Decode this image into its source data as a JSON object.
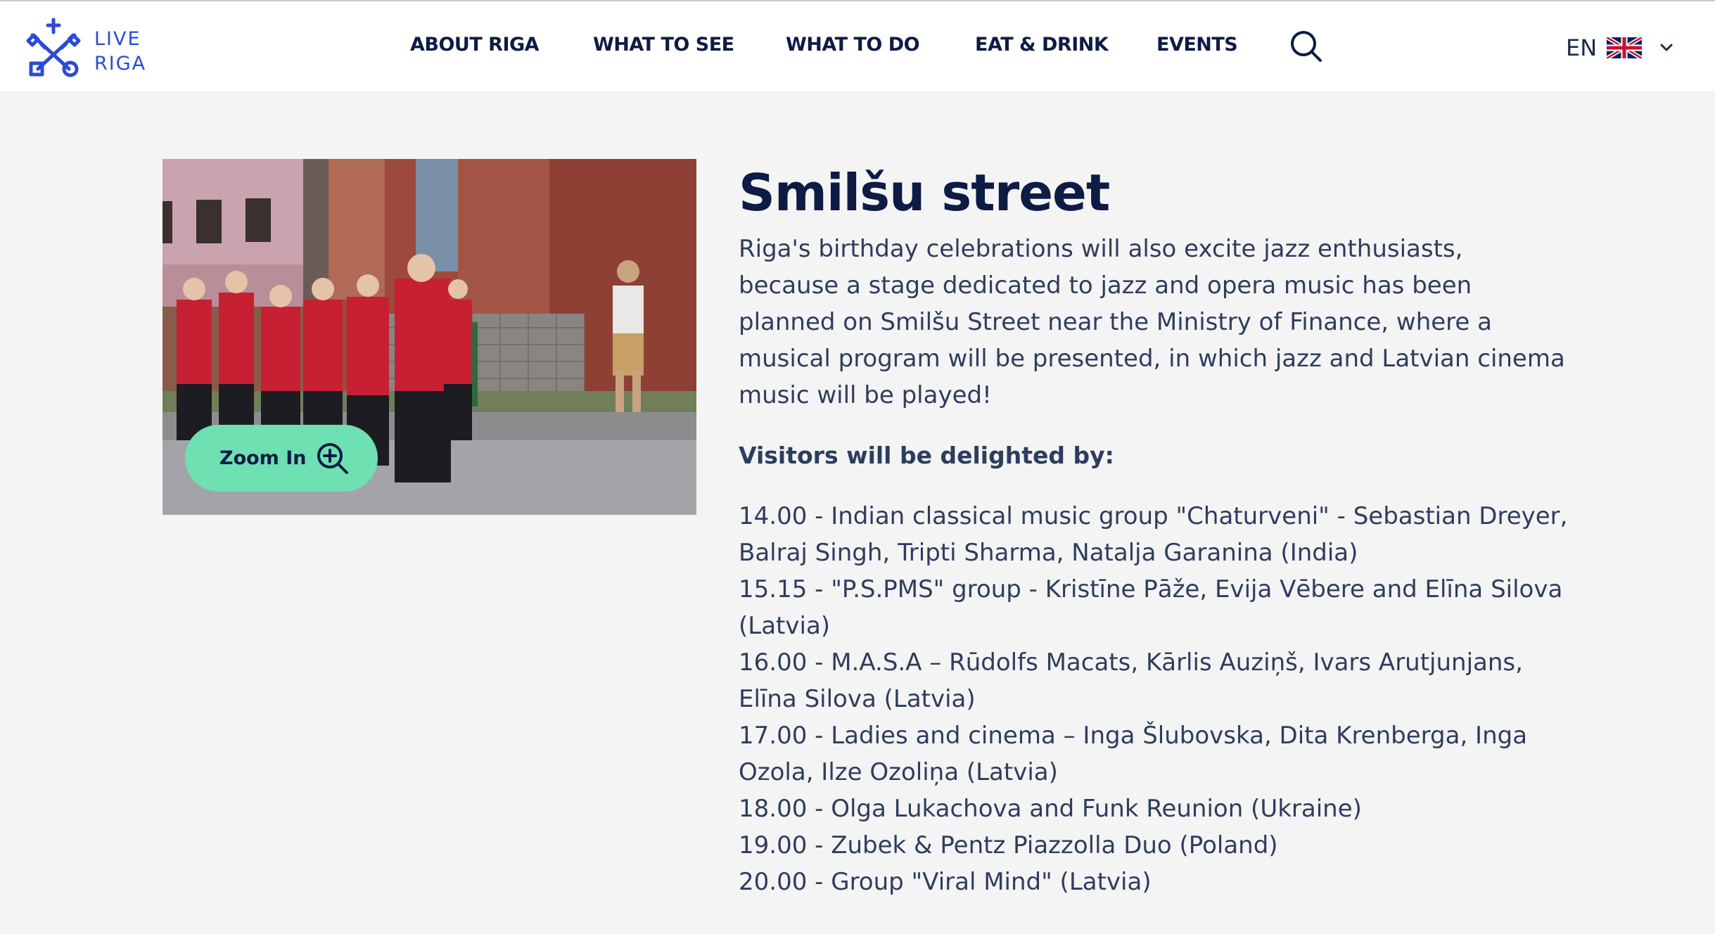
{
  "header": {
    "logo": {
      "line1": "LIVE",
      "line2": "RIGA",
      "icon": "riga-keys-icon",
      "color": "#2b4bd6"
    },
    "nav": [
      {
        "label": "ABOUT RIGA"
      },
      {
        "label": "WHAT TO SEE"
      },
      {
        "label": "WHAT TO DO"
      },
      {
        "label": "EAT & DRINK"
      },
      {
        "label": "EVENTS"
      }
    ],
    "search_icon": "search-icon",
    "language": {
      "code": "EN",
      "flag_icon": "uk-flag-icon",
      "dropdown_icon": "chevron-down-icon"
    }
  },
  "image_card": {
    "zoom_label": "Zoom In",
    "zoom_icon": "zoom-in-icon",
    "zoom_button_color": "#6ee0b2"
  },
  "article": {
    "title": "Smilšu street",
    "intro": "Riga's birthday celebrations will also excite jazz enthusiasts, because a stage dedicated to jazz and opera music has been planned on Smilšu Street near the Ministry of Finance, where a musical program will be presented, in which jazz and Latvian cinema music will be played!",
    "subheading": "Visitors will be delighted by:",
    "program": [
      "14.00 - Indian classical music group \"Chaturveni\" - Sebastian Dreyer, Balraj Singh, Tripti Sharma, Natalja Garanina (India)",
      "15.15 - \"P.S.PMS\" group - Kristīne Pāže, Evija Vēbere and Elīna Silova (Latvia)",
      "16.00 - M.A.S.A – Rūdolfs Macats, Kārlis Auziņš, Ivars Arutjunjans, Elīna Silova (Latvia)",
      "17.00 - Ladies and cinema – Inga Šlubovska, Dita Krenberga, Inga Ozola, Ilze Ozoliņa (Latvia)",
      "18.00 - Olga Lukachova and Funk Reunion (Ukraine)",
      "19.00 - Zubek & Pentz Piazzolla Duo (Poland)",
      "20.00 - Group \"Viral Mind\" (Latvia)"
    ]
  },
  "colors": {
    "background": "#f4f4f4",
    "heading": "#0d1b45",
    "body_text": "#2e3d5e",
    "brand_blue": "#2b4bd6"
  }
}
